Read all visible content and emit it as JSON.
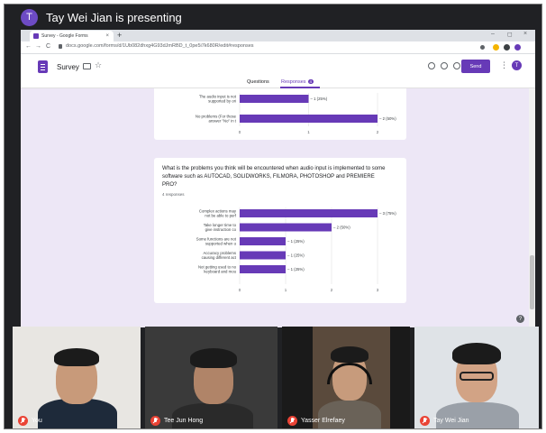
{
  "presenting": {
    "avatar_letter": "T",
    "text": "Tay Wei Jian is presenting"
  },
  "browser": {
    "tab_title": "Survey - Google Forms",
    "tab_close": "×",
    "new_tab": "+",
    "url": "docs.google.com/forms/d/1Ub082dhxg4G93dJmRBD_t_0pe5i7k680R/edit#responses",
    "nav": {
      "back": "←",
      "forward": "→",
      "reload": "C"
    },
    "window": {
      "minimize": "–",
      "maximize": "◻",
      "close": "×"
    }
  },
  "forms": {
    "title": "Survey",
    "star": "☆",
    "send_label": "Send",
    "kebab": "⋮",
    "account_letter": "T",
    "tabs": {
      "questions": "Questions",
      "responses": "Responses",
      "responses_count": "4"
    }
  },
  "chart_data": [
    {
      "type": "bar",
      "orientation": "horizontal",
      "title": "",
      "categories": [
        "The audio input is not supported by ori",
        "No problems (For those answer \"No\" in t"
      ],
      "values": [
        1,
        2
      ],
      "value_labels": [
        "1 (25%)",
        "2 (50%)"
      ],
      "xticks": [
        "0",
        "1",
        "2"
      ],
      "xlim": [
        0,
        2
      ],
      "color": "#673ab7"
    },
    {
      "type": "bar",
      "orientation": "horizontal",
      "title": "What is the problems you think will be encountered when audio input is implemented to some software such as AUTOCAD, SOLIDWORKS, FILMORA, PHOTOSHOP and PREMIERE PRO?",
      "response_count": "4 responses",
      "categories": [
        "Complex actions may not be able to perf",
        "Take longer time to give instruction co",
        "Some functions are not supported when u",
        "Accuracy problems causing different act",
        "Not getting used to no keyboard and mou"
      ],
      "values": [
        3,
        2,
        1,
        1,
        1
      ],
      "value_labels": [
        "3 (75%)",
        "2 (50%)",
        "1 (25%)",
        "1 (25%)",
        "1 (25%)"
      ],
      "xticks": [
        "0",
        "1",
        "2",
        "3"
      ],
      "xlim": [
        0,
        3
      ],
      "color": "#673ab7"
    }
  ],
  "help": "?",
  "participants": [
    {
      "name": "You"
    },
    {
      "name": "Tee Jun Hong"
    },
    {
      "name": "Yasser Elrefaey"
    },
    {
      "name": "Tay Wei Jian"
    }
  ],
  "colors": {
    "accent": "#673ab7",
    "meet_bg": "#202124",
    "content_bg": "#ede7f6",
    "mic_off": "#ea4335"
  }
}
